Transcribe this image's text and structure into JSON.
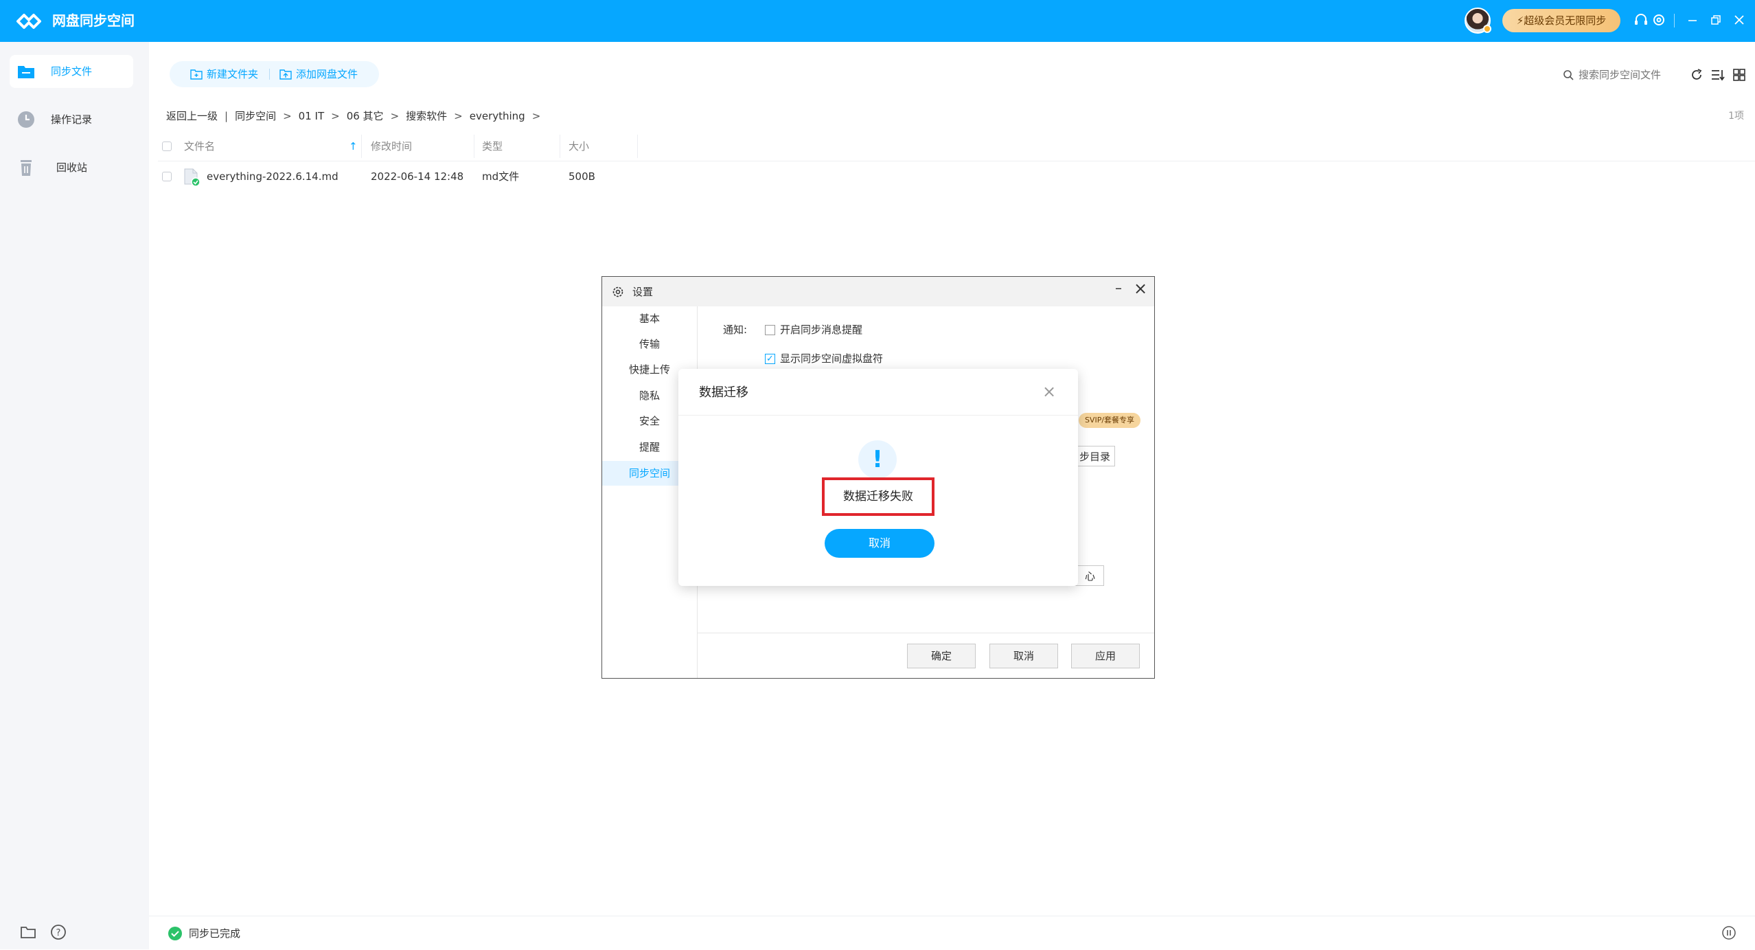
{
  "app": {
    "title": "网盘同步空间"
  },
  "titlebar": {
    "vip_label": "超级会员无限同步",
    "icons": [
      "headset-icon",
      "gear-icon",
      "minimize-icon",
      "restore-icon",
      "close-icon"
    ]
  },
  "sidebar": {
    "items": [
      {
        "label": "同步文件",
        "icon": "folder-sync-icon",
        "active": true
      },
      {
        "label": "操作记录",
        "icon": "clock-icon",
        "active": false
      },
      {
        "label": "回收站",
        "icon": "trash-icon",
        "active": false
      }
    ],
    "bottom_icons": [
      "folder-icon",
      "help-icon"
    ]
  },
  "toolbar": {
    "new_folder": "新建文件夹",
    "add_cloud_file": "添加网盘文件"
  },
  "search": {
    "placeholder": "搜索同步空间文件"
  },
  "breadcrumb": {
    "back": "返回上一级",
    "path": [
      "同步空间",
      "01 IT",
      "06 其它",
      "搜索软件",
      "everything"
    ]
  },
  "item_count": "1项",
  "table": {
    "columns": [
      "文件名",
      "修改时间",
      "类型",
      "大小"
    ],
    "rows": [
      {
        "name": "everything-2022.6.14.md",
        "modified": "2022-06-14 12:48",
        "type": "md文件",
        "size": "500B"
      }
    ]
  },
  "status": {
    "text": "同步已完成"
  },
  "settings": {
    "title": "设置",
    "nav": [
      "基本",
      "传输",
      "快捷上传",
      "隐私",
      "安全",
      "提醒",
      "同步空间"
    ],
    "active_nav": "同步空间",
    "notify_label": "通知:",
    "opt_sync_message": "开启同步消息提醒",
    "opt_show_drive": "显示同步空间虚拟盘符",
    "svip_tag": "SVIP/套餐专享",
    "partial_btn_1": "步目录",
    "partial_btn_2": "心",
    "ok": "确定",
    "cancel": "取消",
    "apply": "应用"
  },
  "modal": {
    "title": "数据迁移",
    "message": "数据迁移失败",
    "cancel": "取消"
  },
  "colors": {
    "brand": "#06a7ff",
    "highlight_border": "#e0262c",
    "success": "#2bc269",
    "vip_gold": "#f5c277"
  }
}
